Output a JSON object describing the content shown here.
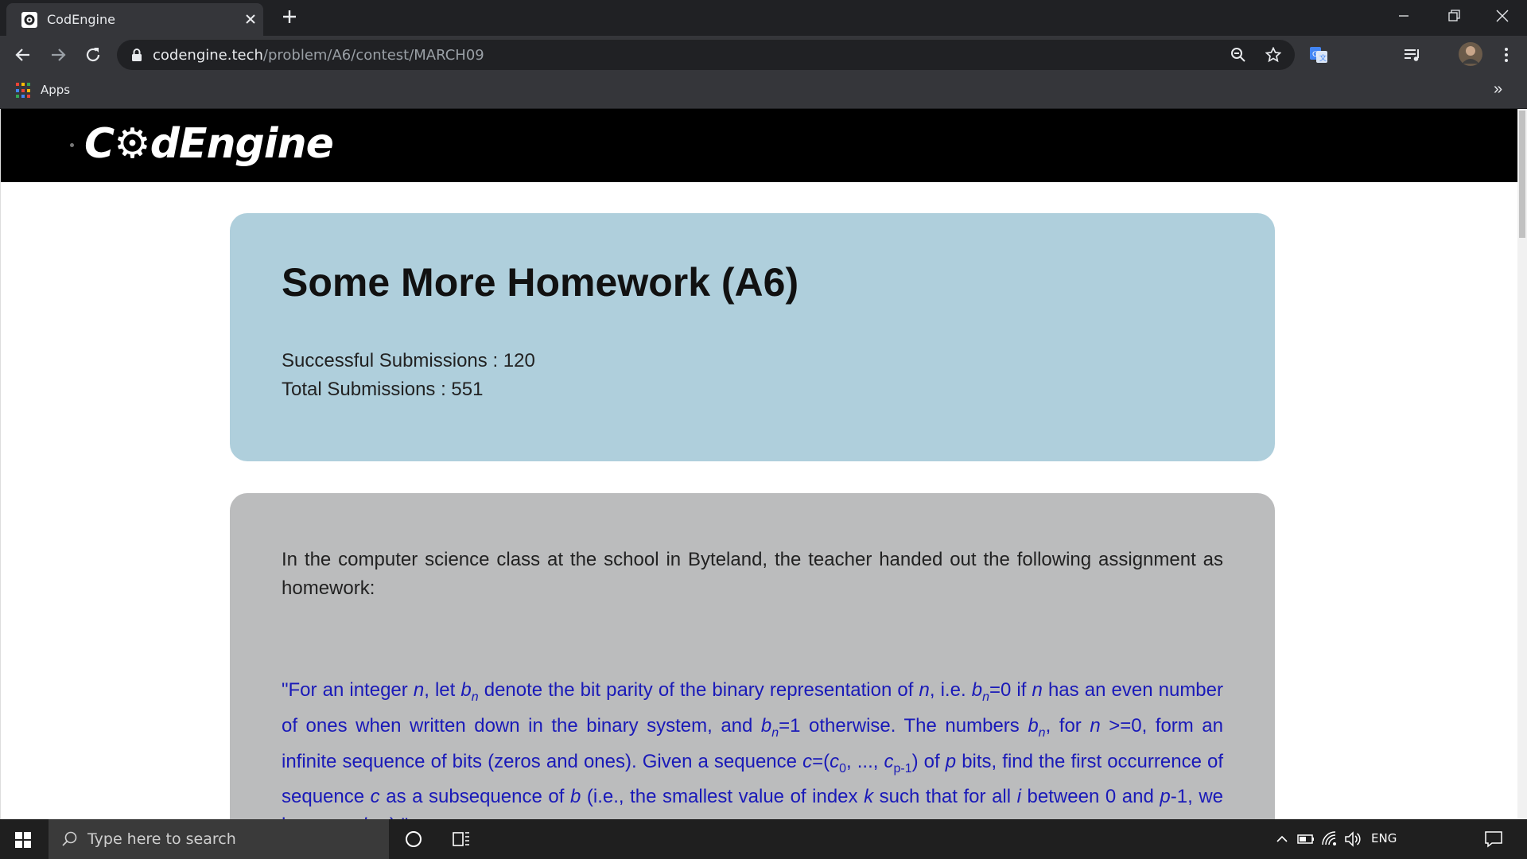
{
  "browser": {
    "tab_title": "CodEngine",
    "url_host": "codengine.tech",
    "url_path": "/problem/A6/contest/MARCH09",
    "bookmarks": [
      {
        "label": "Apps",
        "icon": "apps-grid-icon"
      }
    ],
    "bookmarks_overflow": "»"
  },
  "site": {
    "logo_text": "C⚙dEngine"
  },
  "problem": {
    "title": "Some More Homework (A6)",
    "successful_submissions": "Successful Submissions : 120",
    "total_submissions": "Total Submissions : 551",
    "intro": "In the computer science class at the school in Byteland, the teacher handed out the following assignment as homework:"
  },
  "taskbar": {
    "search_placeholder": "Type here to search",
    "language": "ENG"
  },
  "colors": {
    "chrome_dark": "#202124",
    "chrome_toolbar": "#35363a",
    "info_card": "#afcfdc",
    "desc_card": "#bbbcbd",
    "quote_text": "#1a1ab8",
    "header_bg": "#000000"
  }
}
